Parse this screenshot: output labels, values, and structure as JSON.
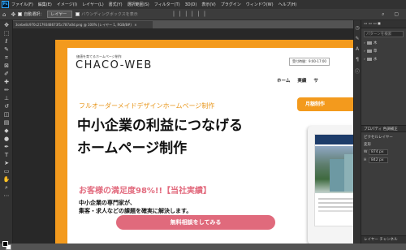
{
  "app": {
    "logo_text": "Ps",
    "menu": [
      "ファイル(F)",
      "編集(E)",
      "イメージ(I)",
      "レイヤー(L)",
      "書式(Y)",
      "選択範囲(S)",
      "フィルター(T)",
      "3D(D)",
      "表示(V)",
      "プラグイン",
      "ウィンドウ(W)",
      "ヘルプ(H)"
    ]
  },
  "options": {
    "auto_select_label": "自動選択：",
    "auto_select_value": "レイヤー",
    "bbox_label": "バウンディングボックスを表示",
    "dots": "⋯"
  },
  "document": {
    "tab_title": "3cebe8c970c2179348673f1c787a0d.png @ 100% (レイヤー 1, RGB/8#)",
    "tab_close": "×"
  },
  "site": {
    "tagline": "価値を育てるホームページ制作",
    "logo": "CHACO-WEB",
    "hours": "受付時間：9:00-17:00",
    "nav": [
      "ホーム",
      "実績",
      "サ"
    ],
    "sub_heading": "フルオーダーメイドデザインホームページ制作",
    "hero_title_line1": "中小企業の利益につなげる",
    "hero_title_line2": "ホームページ制作",
    "side_cta": "月額制作",
    "satisfaction": "お客様の満足度98%!!【当社実績】",
    "desc_line1": "中小企業の専門家が、",
    "desc_line2": "集客・求人などの課題を確実に解決します。",
    "main_cta": "無料相談をしてみる"
  },
  "right_panel": {
    "swatches_search_placeholder": "パターンを検索",
    "swatch_groups": [
      "木",
      "草",
      "水"
    ],
    "properties_tab": "プロパティ",
    "properties_tab2": "色調補正",
    "pixel_layer_label": "ピクセルレイヤー",
    "transform_label": "変形",
    "w_label": "W",
    "w_value": "874 px",
    "h_label": "H",
    "h_value": "842 px",
    "layers_tab": "レイヤー",
    "channels_tab": "チャンネル"
  },
  "colors": {
    "accent_orange": "#f39a1d",
    "accent_pink": "#e06a7c",
    "ps_dark": "#323232"
  }
}
